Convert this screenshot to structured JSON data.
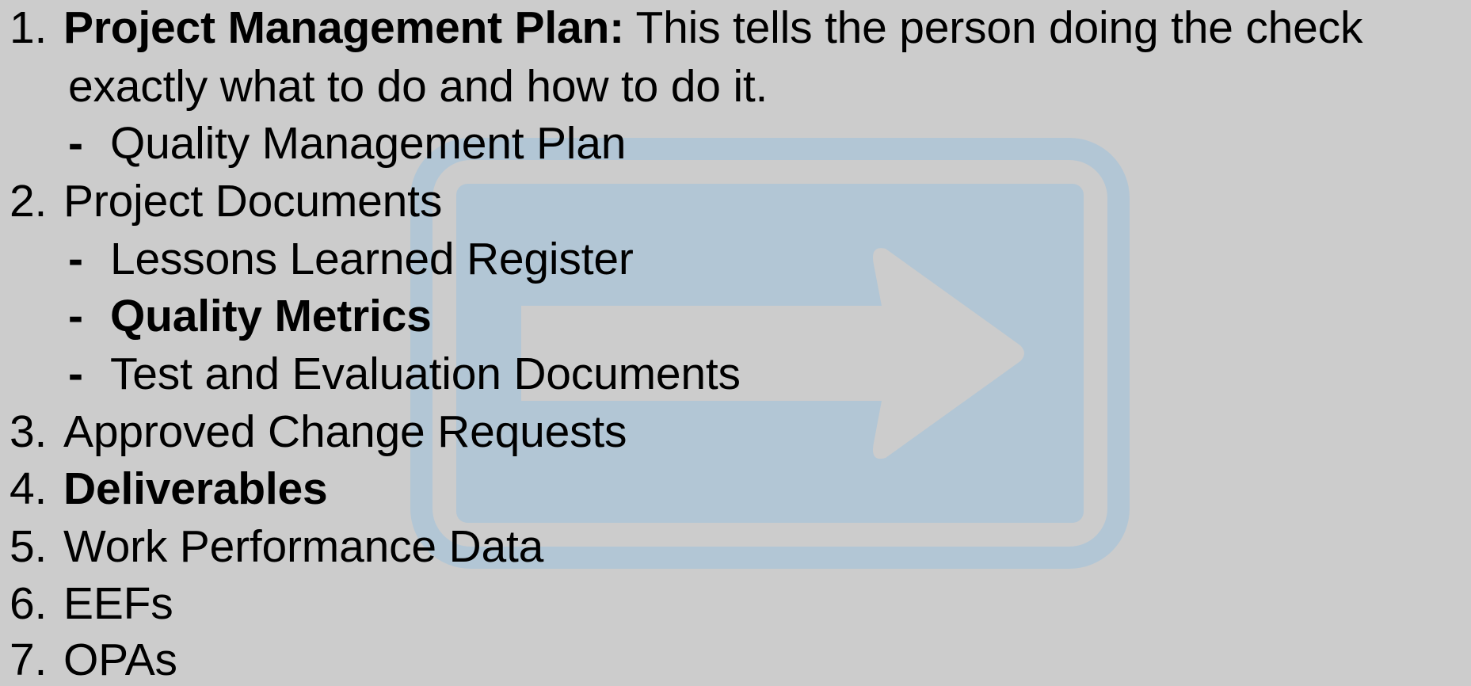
{
  "watermark": {
    "icon": "arrow-right-icon",
    "color": "#a9c4d8"
  },
  "list": {
    "item1": {
      "number": "1.",
      "bold_label": "Project Management Plan:",
      "text_line1": " This tells the person doing the check",
      "text_line2": "exactly what to do and how to do it.",
      "sub": [
        "Quality Management Plan"
      ]
    },
    "item2": {
      "number": "2.",
      "label": "Project Documents",
      "sub": [
        "Lessons Learned Register",
        "Quality Metrics",
        "Test and Evaluation Documents"
      ]
    },
    "item3": {
      "number": "3.",
      "label": "Approved Change Requests"
    },
    "item4": {
      "number": "4.",
      "label": "Deliverables"
    },
    "item5": {
      "number": "5.",
      "label": "Work Performance Data"
    },
    "item6": {
      "number": "6.",
      "label": "EEFs"
    },
    "item7": {
      "number": "7.",
      "label": "OPAs"
    },
    "dash": "-"
  }
}
